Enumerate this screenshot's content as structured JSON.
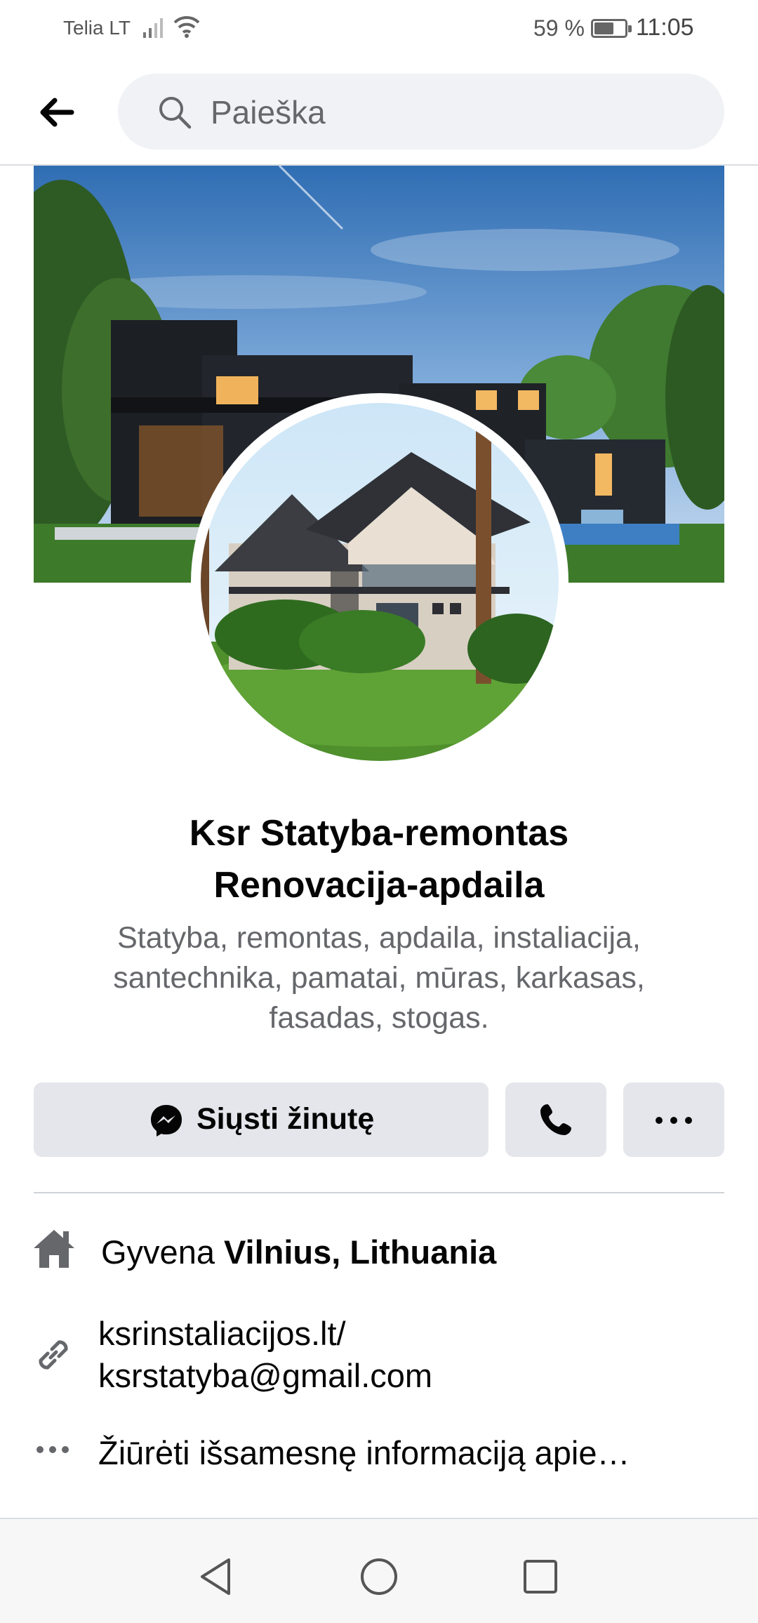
{
  "status": {
    "carrier": "Telia LT",
    "battery_pct": "59 %",
    "battery_level": 0.59,
    "time": "11:05"
  },
  "search": {
    "placeholder": "Paieška"
  },
  "profile": {
    "name_line1": "Ksr Statyba-remontas",
    "name_line2": "Renovacija-apdaila",
    "description": "Statyba, remontas, apdaila, instaliacija, santechnika, pamatai, mūras, karkasas, fasadas, stogas."
  },
  "actions": {
    "message_label": "Siųsti žinutę"
  },
  "info": {
    "lives_prefix": "Gyvena",
    "lives_location": "Vilnius, Lithuania",
    "website": "ksrinstaliacijos.lt/",
    "email": "ksrstatyba@gmail.com",
    "more": "Žiūrėti išsamesnę informaciją apie…"
  },
  "icons": {
    "back": "arrow-left-icon",
    "search": "search-icon",
    "messenger": "messenger-icon",
    "phone": "phone-icon",
    "more": "more-dots-icon",
    "home": "home-icon",
    "link": "link-icon",
    "ellipsis": "ellipsis-icon"
  },
  "colors": {
    "button_bg": "#e4e6eb",
    "search_bg": "#f0f2f5",
    "secondary_text": "#65676b",
    "icon_gray": "#65676b"
  }
}
